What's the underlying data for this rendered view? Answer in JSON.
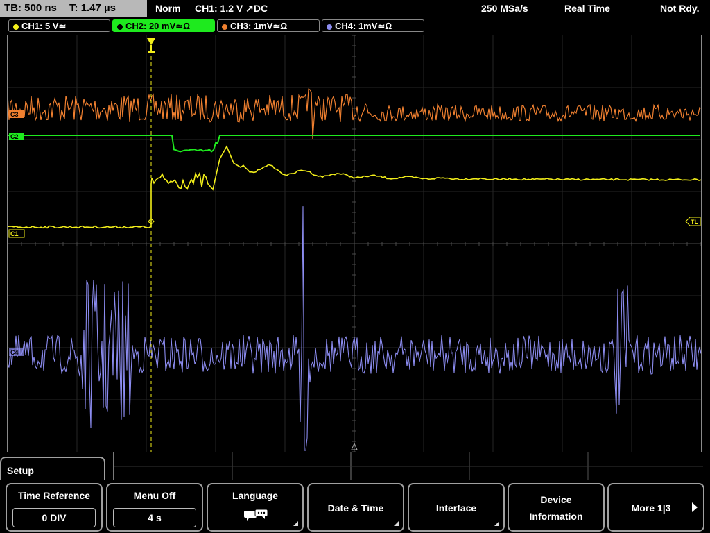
{
  "topbar": {
    "timebase": "TB: 500 ns",
    "trigger_time": "T: 1.47 µs",
    "mode": "Norm",
    "trigger": "CH1: 1.2 V ↗DC",
    "sample_rate": "250 MSa/s",
    "acq_mode": "Real Time",
    "status": "Not Rdy."
  },
  "channels": [
    {
      "label": "CH1: 5 V≃",
      "color": "#f2ee1a",
      "active": false
    },
    {
      "label": "CH2: 20 mV≃Ω",
      "color": "#1eea1e",
      "active": true
    },
    {
      "label": "CH3: 1mV≃Ω",
      "color": "#f08030",
      "active": false
    },
    {
      "label": "CH4: 1mV≃Ω",
      "color": "#8c8cf0",
      "active": false
    }
  ],
  "markers": {
    "ch3": "C3",
    "ch2": "C2",
    "ch1": "C1",
    "ch4": "C4",
    "trigger_level": "TL",
    "trigger_pos": "T"
  },
  "menu": {
    "title": "Setup",
    "softkeys": [
      {
        "label": "Time Reference",
        "value": "0 DIV"
      },
      {
        "label": "Menu Off",
        "value": "4 s"
      },
      {
        "label": "Language",
        "icon": "speech-bubbles-icon"
      },
      {
        "label": "Date & Time"
      },
      {
        "label": "Interface"
      },
      {
        "label1": "Device",
        "label2": "Information"
      },
      {
        "label": "More 1|3"
      }
    ]
  }
}
